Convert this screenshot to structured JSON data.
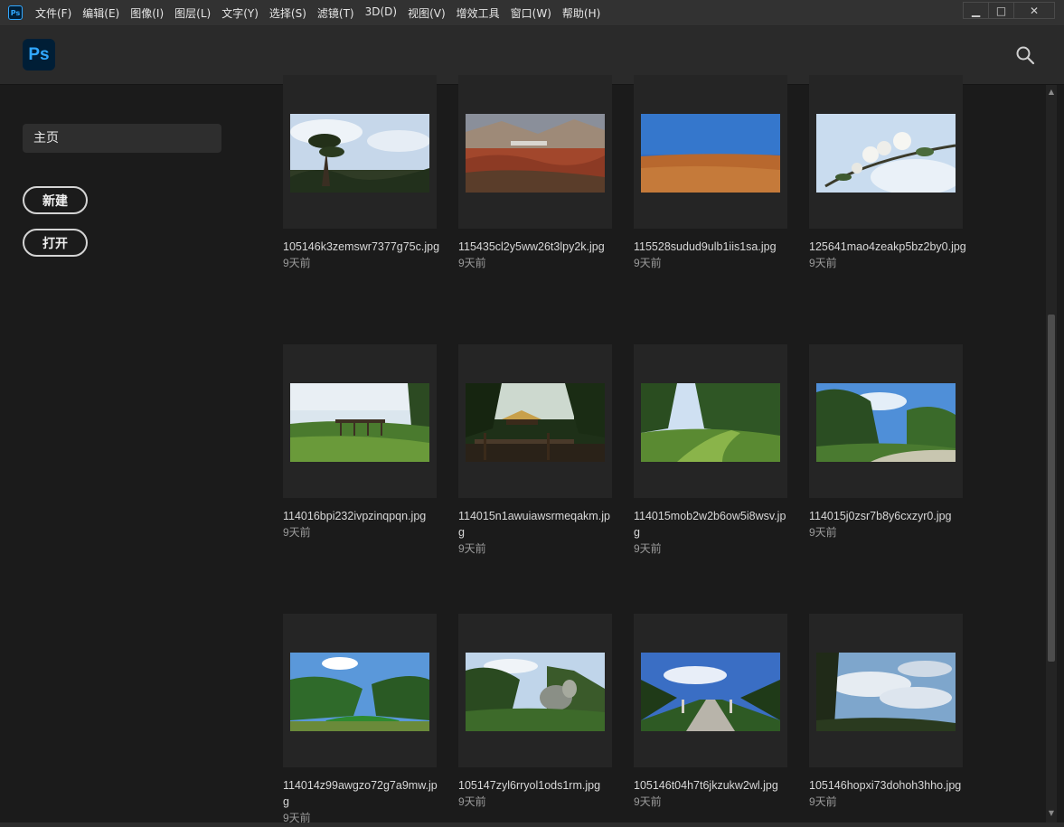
{
  "app": {
    "icon_label": "Ps",
    "logo_label": "Ps"
  },
  "menu": [
    "文件(F)",
    "编辑(E)",
    "图像(I)",
    "图层(L)",
    "文字(Y)",
    "选择(S)",
    "滤镜(T)",
    "3D(D)",
    "视图(V)",
    "增效工具",
    "窗口(W)",
    "帮助(H)"
  ],
  "window_controls": {
    "minimize": "▁",
    "maximize": "□",
    "close": "✕"
  },
  "sidebar": {
    "home_label": "主页",
    "new_label": "新建",
    "open_label": "打开"
  },
  "files": [
    {
      "name": "105146k3zemswr7377g75c.jpg",
      "time": "9天前",
      "scene": "pine-sky"
    },
    {
      "name": "115435cl2y5ww26t3lpy2k.jpg",
      "time": "9天前",
      "scene": "red-earth"
    },
    {
      "name": "115528sudud9ulb1iis1sa.jpg",
      "time": "9天前",
      "scene": "blue-field"
    },
    {
      "name": "125641mao4zeakp5bz2by0.jpg",
      "time": "9天前",
      "scene": "blossom"
    },
    {
      "name": "114016bpi232ivpzinqpqn.jpg",
      "time": "9天前",
      "scene": "park-lawn"
    },
    {
      "name": "114015n1awuiawsrmeqakm.jpg",
      "time": "9天前",
      "scene": "pavilion"
    },
    {
      "name": "114015mob2w2b6ow5i8wsv.jpg",
      "time": "9天前",
      "scene": "forest-path"
    },
    {
      "name": "114015j0zsr7b8y6cxzyr0.jpg",
      "time": "9天前",
      "scene": "forest-sky"
    },
    {
      "name": "114014z99awgzo72g7a9mw.jpg",
      "time": "9天前",
      "scene": "river"
    },
    {
      "name": "105147zyl6rryol1ods1rm.jpg",
      "time": "9天前",
      "scene": "rock-garden"
    },
    {
      "name": "105146t04h7t6jkzukw2wl.jpg",
      "time": "9天前",
      "scene": "avenue"
    },
    {
      "name": "105146hopxi73dohoh3hho.jpg",
      "time": "9天前",
      "scene": "clouds"
    }
  ],
  "colors": {
    "accent": "#31a8ff",
    "logo_bg": "#001e36",
    "background": "#1b1b1b"
  },
  "icons": {
    "search": "search-icon"
  }
}
